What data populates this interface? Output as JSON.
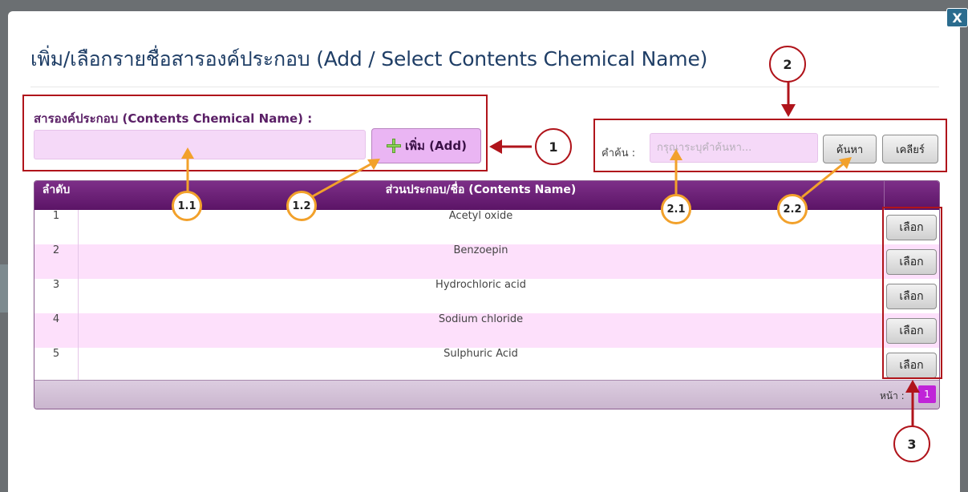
{
  "dialog": {
    "title": "เพิ่ม/เลือกรายชื่อสารองค์ประกอบ (Add / Select Contents Chemical Name)",
    "close_label": "X"
  },
  "add_form": {
    "label": "สารองค์ประกอบ (Contents Chemical Name) :",
    "input_value": "",
    "add_button_label": "เพิ่ม (Add)"
  },
  "search": {
    "label": "คำค้น :",
    "placeholder": "กรุณาระบุคำค้นหา...",
    "search_button_label": "ค้นหา",
    "clear_button_label": "เคลียร์"
  },
  "table": {
    "headers": [
      "ลำดับ",
      "ส่วนประกอบ/ชื่อ (Contents Name)"
    ],
    "select_label": "เลือก",
    "rows": [
      {
        "no": "1",
        "name": "Acetyl oxide"
      },
      {
        "no": "2",
        "name": "Benzoepin"
      },
      {
        "no": "3",
        "name": "Hydrochloric acid"
      },
      {
        "no": "4",
        "name": "Sodium chloride"
      },
      {
        "no": "5",
        "name": "Sulphuric Acid"
      }
    ],
    "pagination": {
      "label": "หน้า :",
      "current_page": "1"
    }
  },
  "annotations": {
    "badges": [
      "1",
      "2",
      "3",
      "1.1",
      "1.2",
      "2.1",
      "2.2"
    ],
    "red_color": "#b0141b",
    "orange_color": "#f2a12b"
  },
  "colors": {
    "header_purple": "#6a1f75",
    "row_alt_pink": "#fde0fb",
    "input_pink": "#f5d9f8",
    "title_blue": "#1f3e66",
    "page_magenta": "#c023d8"
  }
}
